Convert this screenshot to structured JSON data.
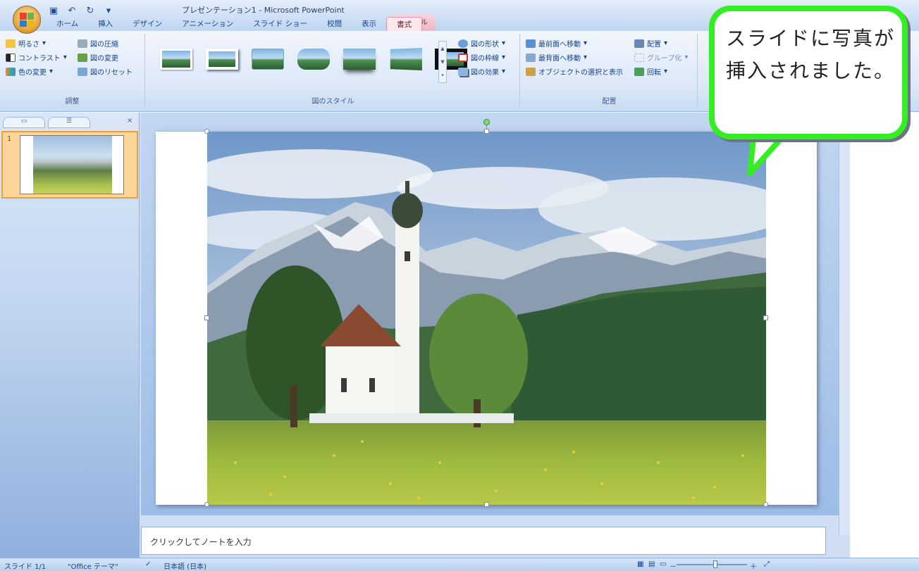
{
  "window": {
    "title": "プレゼンテーション1 - Microsoft PowerPoint",
    "context_tool": "図ツール"
  },
  "qat": {
    "save_icon": "save-icon",
    "undo_icon": "undo-icon",
    "redo_icon": "redo-icon"
  },
  "tabs": [
    {
      "label": "ホーム"
    },
    {
      "label": "挿入"
    },
    {
      "label": "デザイン"
    },
    {
      "label": "アニメーション"
    },
    {
      "label": "スライド ショー"
    },
    {
      "label": "校閲"
    },
    {
      "label": "表示"
    },
    {
      "label": "書式",
      "active": true
    }
  ],
  "ribbon": {
    "adjust": {
      "label": "調整",
      "brightness": "明るさ",
      "contrast": "コントラスト",
      "recolor": "色の変更",
      "compress": "図の圧縮",
      "change_picture": "図の変更",
      "reset_picture": "図のリセット"
    },
    "picture_styles": {
      "label": "図のスタイル",
      "shape": "図の形状",
      "border": "図の枠線",
      "effects": "図の効果"
    },
    "arrange": {
      "label": "配置",
      "bring_front": "最前面へ移動",
      "send_back": "最背面へ移動",
      "selection_pane": "オブジェクトの選択と表示",
      "align": "配置",
      "group": "グループ化",
      "rotate": "回転"
    }
  },
  "slides_pane": {
    "slide_number": "1"
  },
  "notes": {
    "placeholder": "クリックしてノートを入力"
  },
  "status": {
    "slide": "スライド 1/1",
    "theme": "\"Office テーマ\"",
    "language": "日本語 (日本)",
    "zoom_pct": 0.55
  },
  "callout": {
    "text": "スライドに写真が挿入されました。",
    "color": "#33ee22"
  }
}
